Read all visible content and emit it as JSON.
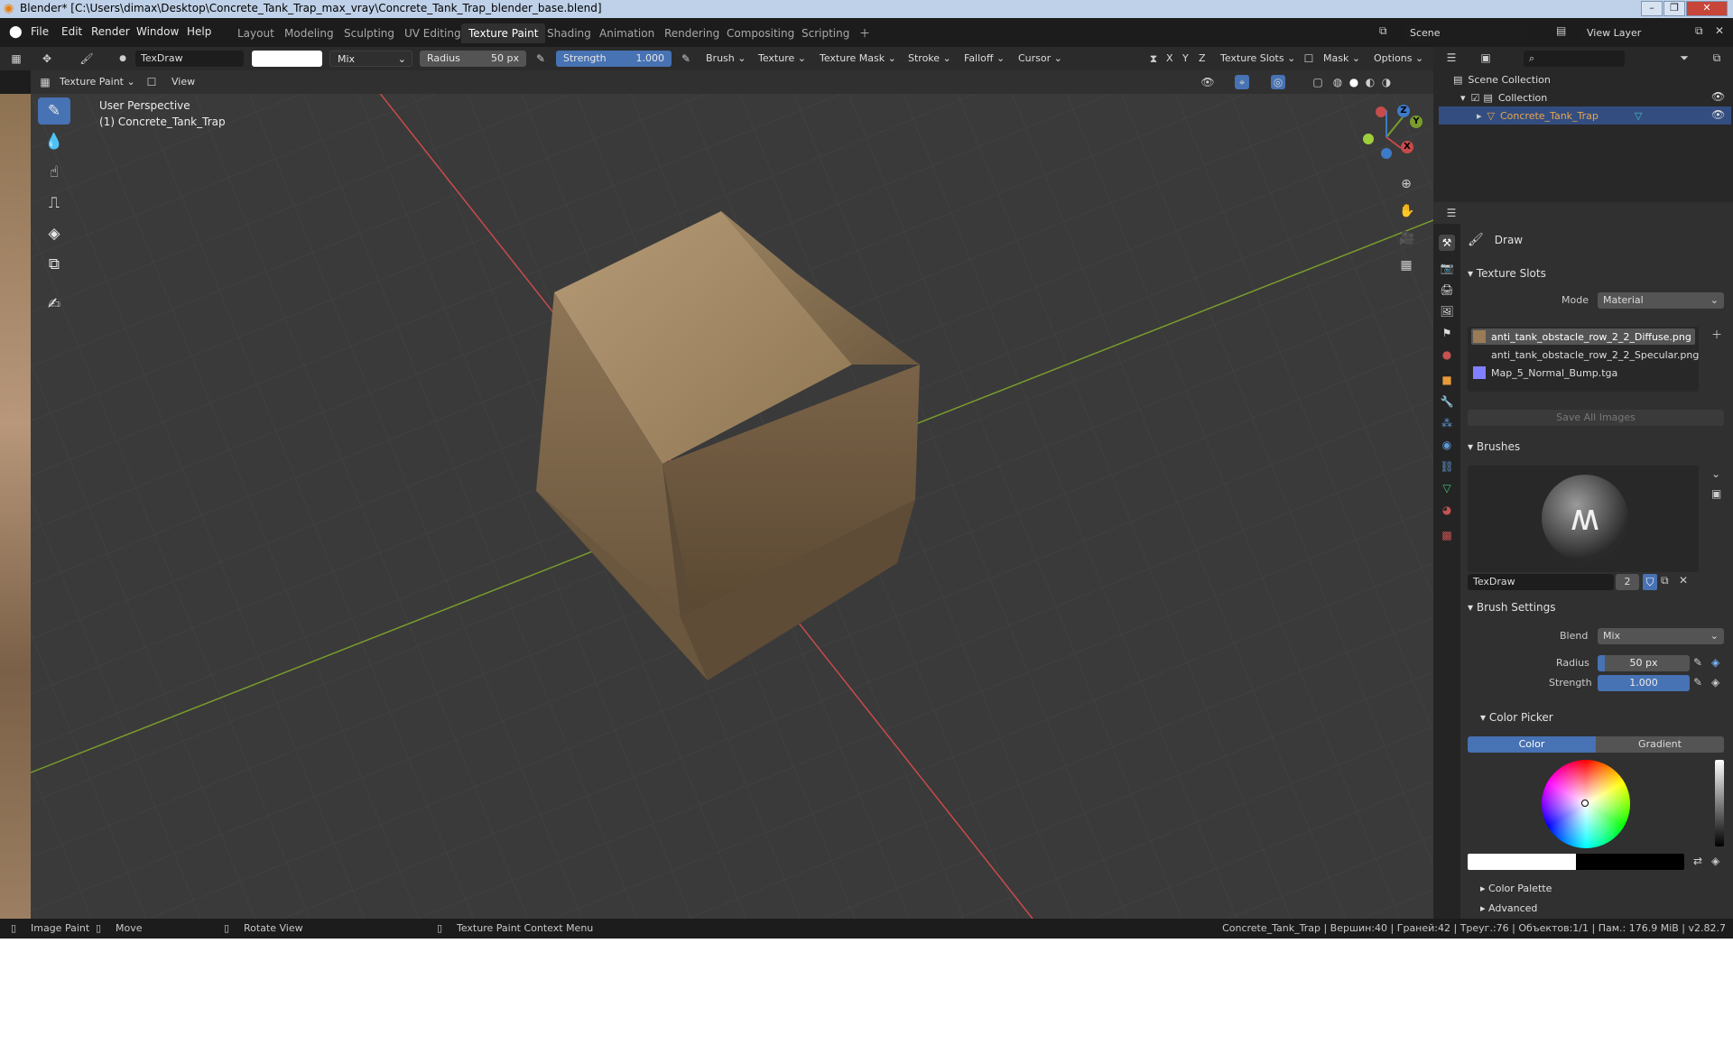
{
  "window": {
    "title": "Blender* [C:\\Users\\dimax\\Desktop\\Concrete_Tank_Trap_max_vray\\Concrete_Tank_Trap_blender_base.blend]"
  },
  "menus": [
    "File",
    "Edit",
    "Render",
    "Window",
    "Help"
  ],
  "workspaces": [
    "Layout",
    "Modeling",
    "Sculpting",
    "UV Editing",
    "Texture Paint",
    "Shading",
    "Animation",
    "Rendering",
    "Compositing",
    "Scripting"
  ],
  "active_workspace": "Texture Paint",
  "scene": {
    "scene_label": "Scene",
    "view_layer": "View Layer"
  },
  "tool_header": {
    "brush_name": "TexDraw",
    "blend": "Mix",
    "radius_label": "Radius",
    "radius_value": "50 px",
    "strength_label": "Strength",
    "strength_value": "1.000",
    "menus": [
      "Brush",
      "Texture",
      "Texture Mask",
      "Stroke",
      "Falloff",
      "Cursor"
    ],
    "axes": [
      "X",
      "Y",
      "Z"
    ],
    "texture_slots": "Texture Slots",
    "mask": "Mask",
    "options": "Options"
  },
  "view_header": {
    "mode": "Texture Paint",
    "view": "View"
  },
  "viewport": {
    "perspective": "User Perspective",
    "object_label": "(1) Concrete_Tank_Trap",
    "gizmo": {
      "x": "X",
      "y": "Y",
      "z": "Z"
    }
  },
  "outliner": {
    "root": "Scene Collection",
    "collection": "Collection",
    "object": "Concrete_Tank_Trap"
  },
  "props": {
    "tool_name": "Draw",
    "texture_slots_title": "Texture Slots",
    "mode_label": "Mode",
    "mode_value": "Material",
    "slots": [
      "anti_tank_obstacle_row_2_2_Diffuse.png",
      "anti_tank_obstacle_row_2_2_Specular.png",
      "Map_5_Normal_Bump.tga"
    ],
    "save_all": "Save All Images",
    "brushes_title": "Brushes",
    "brush_name": "TexDraw",
    "brush_users": "2",
    "brush_settings_title": "Brush Settings",
    "blend_label": "Blend",
    "blend_value": "Mix",
    "radius_label": "Radius",
    "radius_value": "50 px",
    "strength_label": "Strength",
    "strength_value": "1.000",
    "color_picker_title": "Color Picker",
    "color_tab": "Color",
    "gradient_tab": "Gradient",
    "color_palette": "Color Palette",
    "advanced": "Advanced"
  },
  "status": {
    "left": [
      "Image Paint",
      "Move",
      "Rotate View",
      "Texture Paint Context Menu"
    ],
    "right": "Concrete_Tank_Trap | Вершин:40 | Граней:42 | Треуг.:76 | Объектов:1/1 | Пам.: 176.9 MiB | v2.82.7"
  },
  "colors": {
    "accent": "#4772b3",
    "x_axis": "#c74b4b",
    "y_axis": "#7a9c2c",
    "z_axis": "#3d7ac7"
  }
}
